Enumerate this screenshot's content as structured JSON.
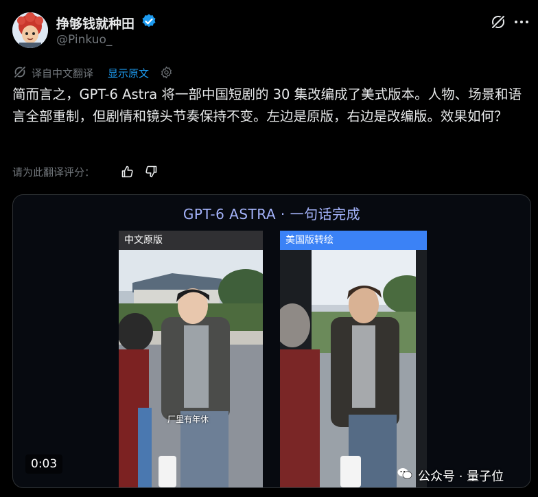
{
  "author": {
    "display_name": "挣够钱就种田",
    "handle": "@Pinkuo_"
  },
  "translation": {
    "from_label": "译自中文翻译",
    "show_original": "显示原文"
  },
  "tweet": {
    "text": "简而言之，GPT-6 Astra 将一部中国短剧的 30 集改编成了美式版本。人物、场景和语言全部重制，但剧情和镜头节奏保持不变。左边是原版，右边是改编版。效果如何？"
  },
  "rating": {
    "label": "请为此翻译评分："
  },
  "media": {
    "title": "GPT-6 ASTRA ·   一句话完成",
    "left_label": "中文原版",
    "right_label": "美国版转绘",
    "subtitle": "厂里有年休",
    "duration": "0:03",
    "watermark": "公众号 · 量子位"
  },
  "colors": {
    "accent": "#1d9bf0",
    "muted": "#71767b",
    "text": "#e7e9ea",
    "right_label_bg": "#3b82f6",
    "title": "#a5b4fc"
  },
  "icons": [
    "verified-badge-icon",
    "grok-icon",
    "more-icon",
    "translate-icon",
    "settings-icon",
    "thumb-up-icon",
    "thumb-down-icon",
    "wechat-icon"
  ]
}
